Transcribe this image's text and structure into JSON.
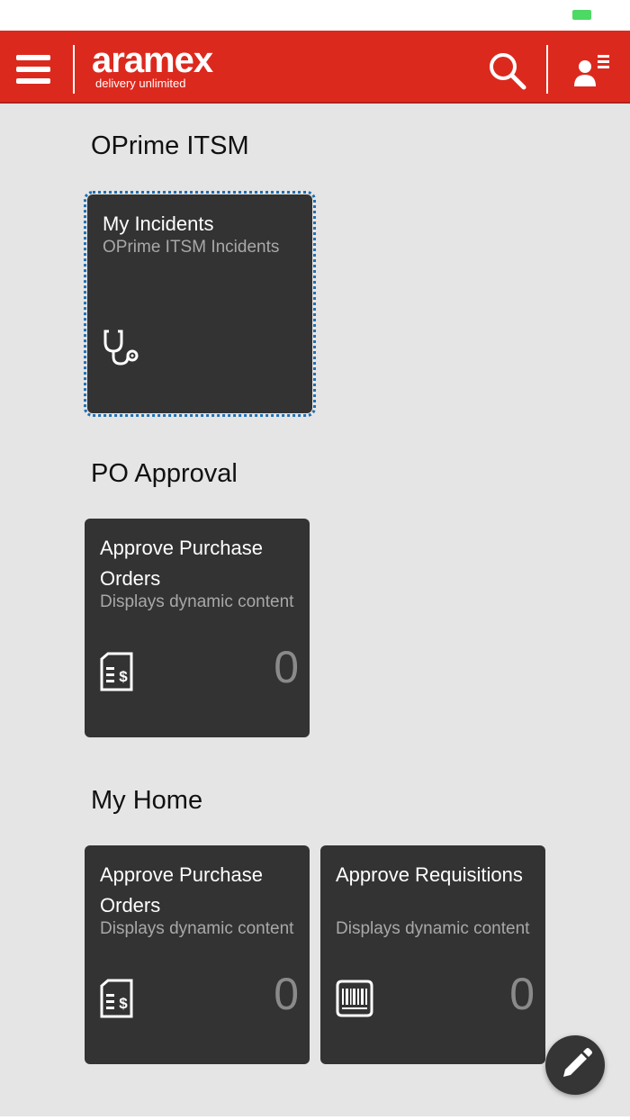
{
  "header": {
    "logo_word": "aramex",
    "logo_tagline": "delivery unlimited",
    "menu_icon": "hamburger-menu-icon",
    "search_icon": "search-icon",
    "user_icon": "user-menu-icon",
    "brand_color": "#dc291e"
  },
  "groups": [
    {
      "title": "OPrime ITSM",
      "tiles": [
        {
          "title": "My Incidents",
          "subtitle": "OPrime ITSM Incidents",
          "icon": "stethoscope-icon"
        }
      ]
    },
    {
      "title": "PO Approval",
      "tiles": [
        {
          "title": "Approve Purchase Orders",
          "subtitle": "Displays dynamic content",
          "icon": "invoice-dollar-icon",
          "count": "0"
        }
      ]
    },
    {
      "title": "My Home",
      "tiles": [
        {
          "title": "Approve Purchase Orders",
          "subtitle": "Displays dynamic content",
          "icon": "invoice-dollar-icon",
          "count": "0"
        },
        {
          "title": "Approve Requisitions",
          "subtitle": "Displays dynamic content",
          "icon": "barcode-icon",
          "count": "0"
        }
      ]
    }
  ],
  "fab": {
    "icon": "edit-pencil-icon"
  },
  "colors": {
    "tile_bg": "#333333",
    "page_bg": "#e5e5e5",
    "status_battery": "#4cd964"
  }
}
